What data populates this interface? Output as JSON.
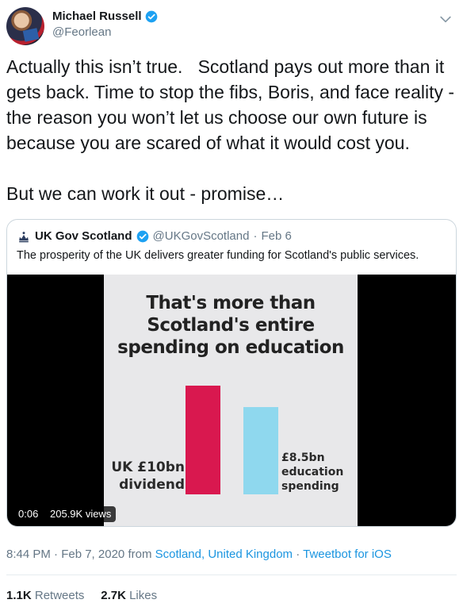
{
  "author": {
    "display_name": "Michael Russell",
    "handle": "@Feorlean",
    "avatar_icon": "profile-photo",
    "verified_icon": "verified-badge-icon"
  },
  "tweet": {
    "text": "Actually this isn’t true.   Scotland pays out more than it gets back. Time to stop the fibs, Boris, and face reality - the reason you won’t let us choose our own future is because you are scared of what it would cost you.\n\nBut we can work it out - promise…"
  },
  "quote": {
    "display_name": "UK Gov Scotland",
    "handle": "@UKGovScotland",
    "separator": "·",
    "date": "Feb 6",
    "text": "The prosperity of the UK delivers greater funding for Scotland's public services.",
    "video": {
      "title": "That's more than\nScotland's entire\nspending on education",
      "bar1_label": "UK £10bn\ndividend",
      "bar2_label": "£8.5bn\neducation\nspending",
      "time": "0:06",
      "views": "205.9K views",
      "colors": {
        "bar1": "#d9184f",
        "bar2": "#8fd8ee"
      }
    }
  },
  "meta": {
    "timestamp": "8:44 PM · Feb 7, 2020",
    "from_label": "from",
    "location": "Scotland, United Kingdom",
    "separator": "·",
    "client": "Tweetbot for iOS"
  },
  "stats": {
    "retweets_count": "1.1K",
    "retweets_label": "Retweets",
    "likes_count": "2.7K",
    "likes_label": "Likes"
  },
  "colors": {
    "link": "#1b95e0",
    "muted": "#657786",
    "text": "#14171a"
  }
}
